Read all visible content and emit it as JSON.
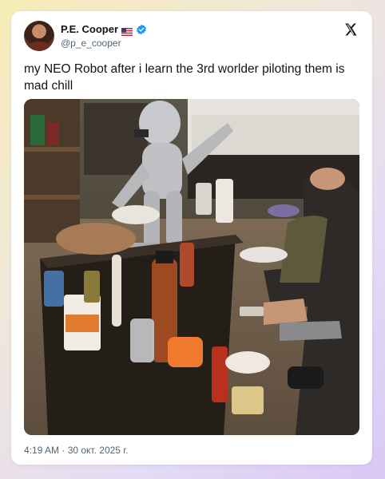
{
  "author": {
    "name": "P.E. Cooper",
    "handle": "@p_e_cooper",
    "flag_icon": "us-flag-icon",
    "verified_icon": "verified-badge-icon",
    "verified_color": "#1d9bf0"
  },
  "tweet": {
    "text": "my NEO Robot after i learn the 3rd worlder piloting them is mad chill",
    "timestamp": "4:19 AM · 30 окт. 2025 г."
  },
  "media": {
    "description_icon": "photo"
  },
  "brand": {
    "logo_icon": "x-logo-icon"
  }
}
